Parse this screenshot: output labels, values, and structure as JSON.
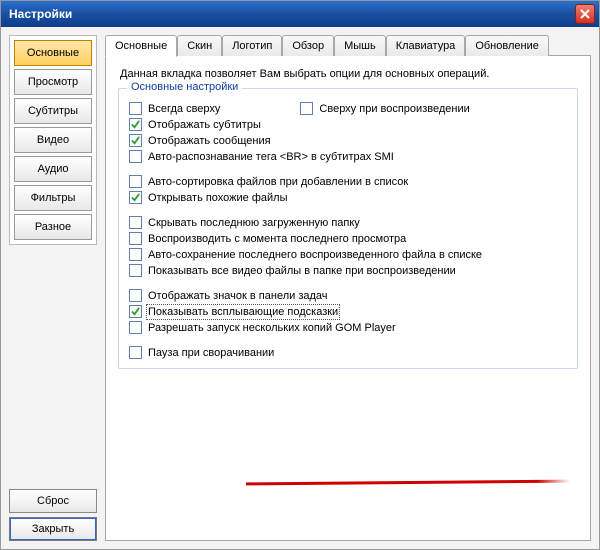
{
  "window": {
    "title": "Настройки"
  },
  "sidebar": {
    "items": [
      {
        "label": "Основные",
        "active": true
      },
      {
        "label": "Просмотр",
        "active": false
      },
      {
        "label": "Субтитры",
        "active": false
      },
      {
        "label": "Видео",
        "active": false
      },
      {
        "label": "Аудио",
        "active": false
      },
      {
        "label": "Фильтры",
        "active": false
      },
      {
        "label": "Разное",
        "active": false
      }
    ],
    "reset": "Сброс",
    "close": "Закрыть"
  },
  "tabs": [
    {
      "label": "Основные",
      "active": true
    },
    {
      "label": "Скин"
    },
    {
      "label": "Логотип"
    },
    {
      "label": "Обзор"
    },
    {
      "label": "Мышь"
    },
    {
      "label": "Клавиатура"
    },
    {
      "label": "Обновление"
    }
  ],
  "panel": {
    "intro": "Данная вкладка позволяет Вам выбрать опции для основных операций.",
    "group_title": "Основные настройки",
    "options": [
      {
        "label": "Всегда сверху",
        "checked": false
      },
      {
        "label": "Сверху при воспроизведении",
        "checked": false
      },
      {
        "label": "Отображать субтитры",
        "checked": true
      },
      {
        "label": "Отображать сообщения",
        "checked": true
      },
      {
        "label": "Авто-распознавание тега <BR> в субтитрах SMI",
        "checked": false
      },
      {
        "label": "Авто-сортировка файлов при добавлении в список",
        "checked": false
      },
      {
        "label": "Открывать похожие файлы",
        "checked": true
      },
      {
        "label": "Скрывать последнюю загруженную папку",
        "checked": false
      },
      {
        "label": "Воспроизводить с момента последнего просмотра",
        "checked": false
      },
      {
        "label": "Авто-сохранение последнего воспроизведенного файла в списке",
        "checked": false
      },
      {
        "label": "Показывать все видео файлы в папке при воспроизведении",
        "checked": false
      },
      {
        "label": "Отображать значок в панели задач",
        "checked": false
      },
      {
        "label": "Показывать всплывающие подсказки",
        "checked": true,
        "focused": true
      },
      {
        "label": "Разрешать запуск нескольких копий GOM Player",
        "checked": false
      },
      {
        "label": "Пауза при сворачивании",
        "checked": false
      }
    ]
  }
}
